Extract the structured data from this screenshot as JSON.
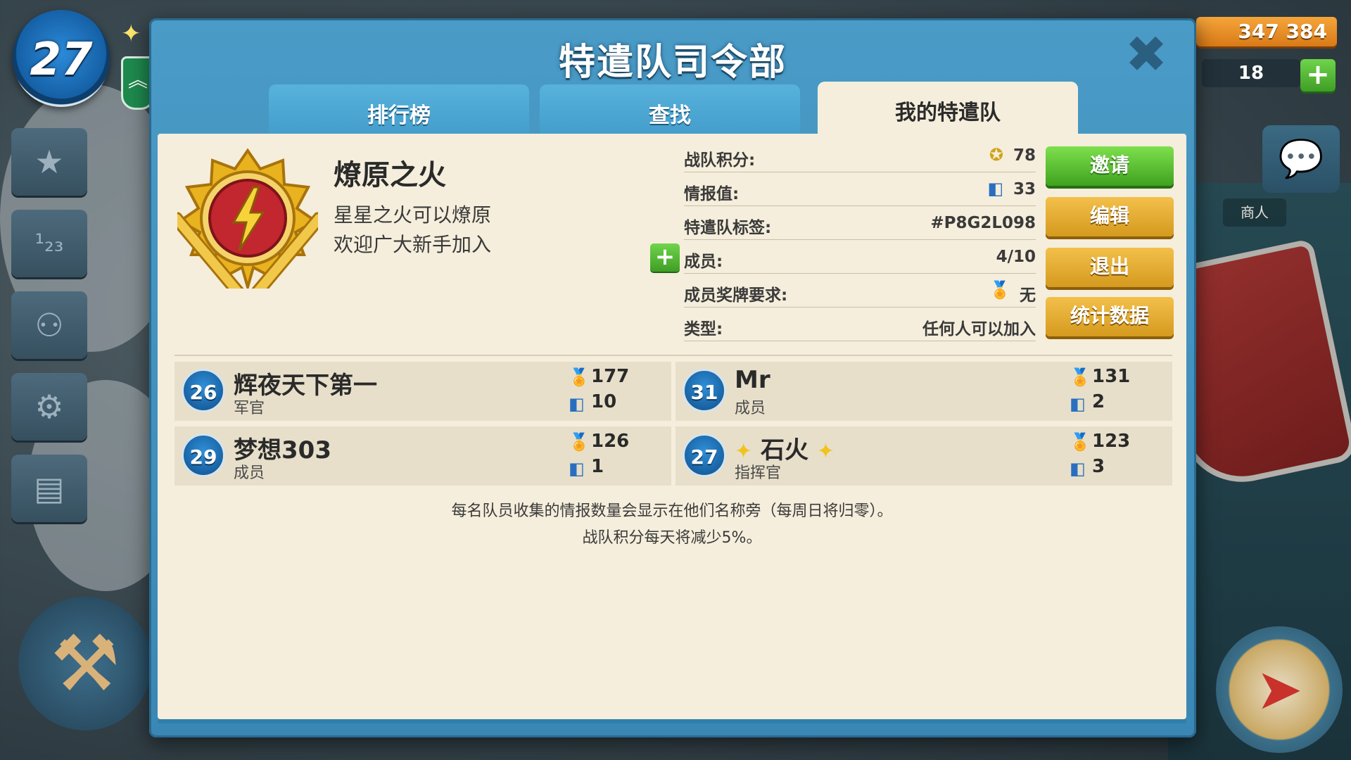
{
  "hud": {
    "player_level": "27",
    "gold": "347 384",
    "diamonds": "18",
    "merchant_label": "商人"
  },
  "modal": {
    "title": "特遣队司令部",
    "tabs": [
      {
        "label": "排行榜"
      },
      {
        "label": "查找"
      },
      {
        "label": "我的特遣队"
      }
    ]
  },
  "team": {
    "name": "燎原之火",
    "description_lines": [
      "星星之火可以燎原",
      "欢迎广大新手加入"
    ],
    "stats": [
      {
        "label": "战队积分:",
        "value": "78"
      },
      {
        "label": "情报值:",
        "value": "33"
      },
      {
        "label": "特遣队标签:",
        "value": "#P8G2L098"
      },
      {
        "label": "成员:",
        "value": "4/10"
      },
      {
        "label": "成员奖牌要求:",
        "value": "无"
      },
      {
        "label": "类型:",
        "value": "任何人可以加入"
      }
    ]
  },
  "actions": {
    "invite": "邀请",
    "edit": "编辑",
    "leave": "退出",
    "statistics": "统计数据"
  },
  "members": [
    {
      "level": "26",
      "name": "辉夜天下第一",
      "role": "军官",
      "medals": "177",
      "intel": "10"
    },
    {
      "level": "31",
      "name": "Mr",
      "role": "成员",
      "medals": "131",
      "intel": "2"
    },
    {
      "level": "29",
      "name": "梦想303",
      "role": "成员",
      "medals": "126",
      "intel": "1"
    },
    {
      "level": "27",
      "name": "石火",
      "role": "指挥官",
      "medals": "123",
      "intel": "3"
    }
  ],
  "notes": {
    "line1": "每名队员收集的情报数量会显示在他们名称旁（每周日将归零）。",
    "line2": "战队积分每天将减少5%。"
  },
  "colors": {
    "modal_blue": "#3a87b5",
    "panel_cream": "#f5eedc",
    "button_green": "#3fa21f",
    "button_gold": "#d59a1e"
  }
}
